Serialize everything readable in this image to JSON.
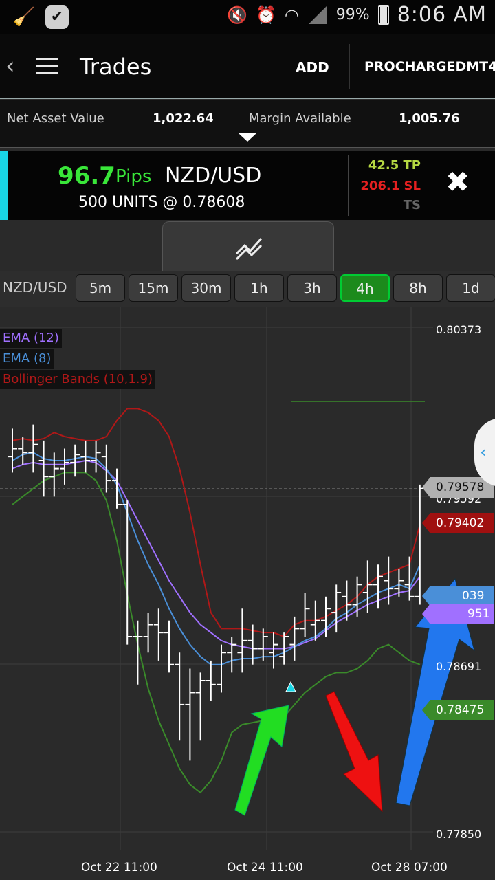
{
  "status_bar": {
    "battery": "99%",
    "time": "8:06 AM",
    "icons": [
      "broom-icon",
      "check-badge-icon",
      "mute-icon",
      "alarm-icon",
      "wifi-icon",
      "signal-icon",
      "battery-icon"
    ]
  },
  "app_bar": {
    "title": "Trades",
    "add_label": "ADD",
    "account_label": "PROCHARGEDMT4"
  },
  "summary": {
    "nav_label": "Net Asset Value",
    "nav_value": "1,022.64",
    "margin_label": "Margin Available",
    "margin_value": "1,005.76"
  },
  "trade": {
    "pips_value": "96.7",
    "pips_unit": "Pips",
    "pair": "NZD/USD",
    "units_line": "500 UNITS @ 0.78608",
    "tp": "42.5 TP",
    "sl": "206.1 SL",
    "ts": "TS",
    "accent": "#19d6e6"
  },
  "timeframes": {
    "pair": "NZD/USD",
    "options": [
      "5m",
      "15m",
      "30m",
      "1h",
      "3h",
      "4h",
      "8h",
      "1d"
    ],
    "active": "4h"
  },
  "chart_data": {
    "type": "candlestick",
    "legend": [
      {
        "name": "EMA (12)",
        "color": "#a070ff"
      },
      {
        "name": "EMA (8)",
        "color": "#4a8fd8"
      },
      {
        "name": "Bollinger Bands (10,1.9)",
        "color": "#b01818"
      }
    ],
    "price_labels": [
      "0.80373",
      "0.79592",
      "0.78691",
      "0.77850"
    ],
    "price_tags": [
      {
        "value": "0.79578",
        "color": "#b0b0b0"
      },
      {
        "value": "0.79402",
        "color": "#a01010"
      },
      {
        "value": "039",
        "color": "#4a8fd8"
      },
      {
        "value": "951",
        "color": "#a070ff"
      },
      {
        "value": "0.78475",
        "color": "#3a8a2a"
      }
    ],
    "time_labels": [
      "Oct 22 11:00",
      "Oct 24 11:00",
      "Oct 28 07:00"
    ],
    "current_price": "0.79578",
    "bars": [
      {
        "o": 0.7974,
        "h": 0.7988,
        "l": 0.7966,
        "c": 0.7978
      },
      {
        "o": 0.7978,
        "h": 0.7984,
        "l": 0.797,
        "c": 0.7976
      },
      {
        "o": 0.7976,
        "h": 0.799,
        "l": 0.7966,
        "c": 0.798
      },
      {
        "o": 0.7972,
        "h": 0.7982,
        "l": 0.7954,
        "c": 0.7964
      },
      {
        "o": 0.7964,
        "h": 0.7976,
        "l": 0.7954,
        "c": 0.7968
      },
      {
        "o": 0.7968,
        "h": 0.7978,
        "l": 0.796,
        "c": 0.7971
      },
      {
        "o": 0.7971,
        "h": 0.798,
        "l": 0.7964,
        "c": 0.7975
      },
      {
        "o": 0.7974,
        "h": 0.7982,
        "l": 0.7966,
        "c": 0.7972
      },
      {
        "o": 0.7972,
        "h": 0.7982,
        "l": 0.7966,
        "c": 0.7976
      },
      {
        "o": 0.7974,
        "h": 0.798,
        "l": 0.7956,
        "c": 0.7962
      },
      {
        "o": 0.7962,
        "h": 0.7968,
        "l": 0.7948,
        "c": 0.795
      },
      {
        "o": 0.795,
        "h": 0.7952,
        "l": 0.788,
        "c": 0.7884
      },
      {
        "o": 0.7884,
        "h": 0.7892,
        "l": 0.786,
        "c": 0.7884
      },
      {
        "o": 0.7884,
        "h": 0.7896,
        "l": 0.7876,
        "c": 0.789
      },
      {
        "o": 0.789,
        "h": 0.7898,
        "l": 0.7872,
        "c": 0.7886
      },
      {
        "o": 0.7886,
        "h": 0.7892,
        "l": 0.7866,
        "c": 0.787
      },
      {
        "o": 0.787,
        "h": 0.7876,
        "l": 0.7832,
        "c": 0.785
      },
      {
        "o": 0.785,
        "h": 0.7868,
        "l": 0.7822,
        "c": 0.7856
      },
      {
        "o": 0.7856,
        "h": 0.7866,
        "l": 0.7832,
        "c": 0.7862
      },
      {
        "o": 0.7862,
        "h": 0.7872,
        "l": 0.7852,
        "c": 0.786
      },
      {
        "o": 0.786,
        "h": 0.788,
        "l": 0.7856,
        "c": 0.7876
      },
      {
        "o": 0.7876,
        "h": 0.7884,
        "l": 0.7866,
        "c": 0.788
      },
      {
        "o": 0.7876,
        "h": 0.7898,
        "l": 0.7866,
        "c": 0.7882
      },
      {
        "o": 0.7882,
        "h": 0.789,
        "l": 0.787,
        "c": 0.7878
      },
      {
        "o": 0.7878,
        "h": 0.7888,
        "l": 0.7872,
        "c": 0.7884
      },
      {
        "o": 0.7876,
        "h": 0.7886,
        "l": 0.7868,
        "c": 0.788
      },
      {
        "o": 0.7874,
        "h": 0.7886,
        "l": 0.787,
        "c": 0.7884
      },
      {
        "o": 0.788,
        "h": 0.7894,
        "l": 0.7872,
        "c": 0.7888
      },
      {
        "o": 0.7888,
        "h": 0.7906,
        "l": 0.7884,
        "c": 0.7898
      },
      {
        "o": 0.789,
        "h": 0.7902,
        "l": 0.7882,
        "c": 0.7892
      },
      {
        "o": 0.7892,
        "h": 0.7904,
        "l": 0.7884,
        "c": 0.7898
      },
      {
        "o": 0.7896,
        "h": 0.791,
        "l": 0.7886,
        "c": 0.7906
      },
      {
        "o": 0.7904,
        "h": 0.7912,
        "l": 0.7892,
        "c": 0.79
      },
      {
        "o": 0.79,
        "h": 0.7914,
        "l": 0.7894,
        "c": 0.791
      },
      {
        "o": 0.7906,
        "h": 0.7922,
        "l": 0.7896,
        "c": 0.791
      },
      {
        "o": 0.791,
        "h": 0.792,
        "l": 0.7898,
        "c": 0.7914
      },
      {
        "o": 0.7912,
        "h": 0.7924,
        "l": 0.79,
        "c": 0.7908
      },
      {
        "o": 0.7908,
        "h": 0.7918,
        "l": 0.7904,
        "c": 0.7912
      },
      {
        "o": 0.791,
        "h": 0.7924,
        "l": 0.7902,
        "c": 0.7904
      },
      {
        "o": 0.7904,
        "h": 0.796,
        "l": 0.79,
        "c": 0.7958
      }
    ],
    "ema12": [
      0.7968,
      0.797,
      0.7971,
      0.797,
      0.797,
      0.797,
      0.7971,
      0.7972,
      0.7971,
      0.7967,
      0.7962,
      0.7952,
      0.7942,
      0.7932,
      0.7922,
      0.7912,
      0.7904,
      0.7896,
      0.789,
      0.7886,
      0.7882,
      0.788,
      0.7879,
      0.7878,
      0.7878,
      0.7878,
      0.7878,
      0.7879,
      0.7881,
      0.7883,
      0.7887,
      0.7891,
      0.7894,
      0.7897,
      0.79,
      0.7902,
      0.7904,
      0.7906,
      0.7907,
      0.7914
    ],
    "ema8": [
      0.7972,
      0.7975,
      0.7976,
      0.7973,
      0.7972,
      0.7972,
      0.7973,
      0.7974,
      0.7973,
      0.7968,
      0.796,
      0.7946,
      0.7932,
      0.792,
      0.791,
      0.7898,
      0.7888,
      0.788,
      0.7874,
      0.787,
      0.787,
      0.7872,
      0.7873,
      0.7873,
      0.7874,
      0.7874,
      0.7876,
      0.7879,
      0.7882,
      0.7884,
      0.7888,
      0.7893,
      0.7896,
      0.79,
      0.7903,
      0.7906,
      0.7908,
      0.791,
      0.7908,
      0.792
    ],
    "bb_upper": [
      0.7982,
      0.7983,
      0.7982,
      0.7983,
      0.7986,
      0.7984,
      0.7983,
      0.7982,
      0.7982,
      0.7984,
      0.7992,
      0.7998,
      0.7998,
      0.7996,
      0.7992,
      0.7984,
      0.7968,
      0.7946,
      0.792,
      0.7896,
      0.7888,
      0.7888,
      0.7888,
      0.7887,
      0.7886,
      0.7886,
      0.7884,
      0.789,
      0.7892,
      0.7892,
      0.7894,
      0.7897,
      0.79,
      0.7904,
      0.791,
      0.7914,
      0.7916,
      0.7918,
      0.792,
      0.794
    ],
    "bb_lower": [
      0.795,
      0.7954,
      0.7958,
      0.7962,
      0.7964,
      0.7966,
      0.7966,
      0.7966,
      0.7962,
      0.7952,
      0.7932,
      0.7905,
      0.788,
      0.7858,
      0.7842,
      0.783,
      0.7818,
      0.781,
      0.7806,
      0.7812,
      0.7822,
      0.7836,
      0.784,
      0.7841,
      0.7842,
      0.784,
      0.7844,
      0.785,
      0.7856,
      0.786,
      0.7864,
      0.7866,
      0.7866,
      0.7868,
      0.7872,
      0.7878,
      0.788,
      0.7876,
      0.7872,
      0.787
    ]
  }
}
